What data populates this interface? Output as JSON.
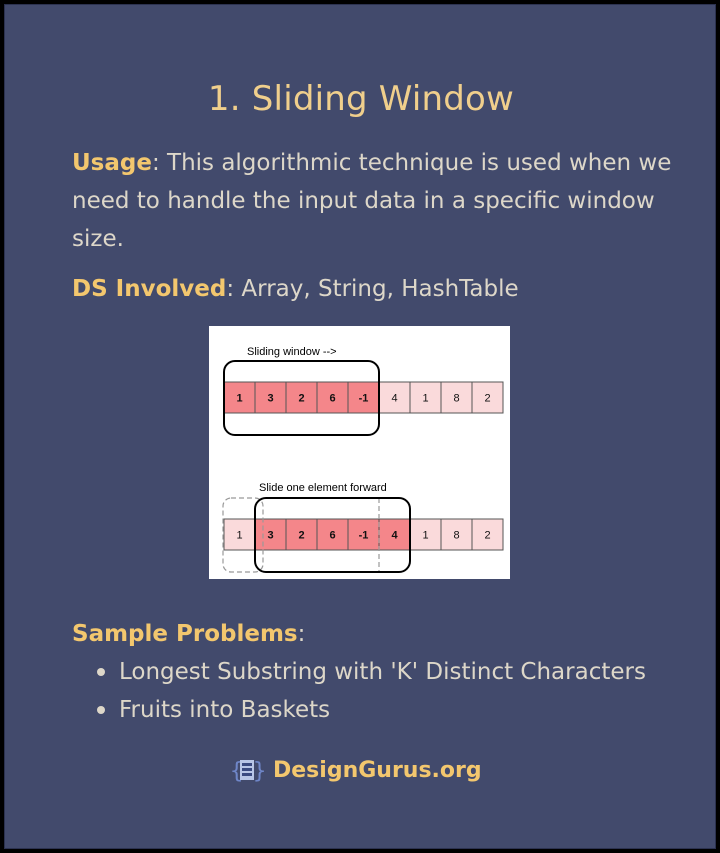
{
  "title": "1. Sliding Window",
  "usage": {
    "label": "Usage",
    "text": ": This algorithmic technique is used when we need to handle the input data in a specific window size."
  },
  "ds": {
    "label": "DS Involved",
    "text": ": Array, String, HashTable"
  },
  "diagram": {
    "caption_top": "Sliding window -->",
    "caption_bottom": "Slide one element forward",
    "array": [
      "1",
      "3",
      "2",
      "6",
      "-1",
      "4",
      "1",
      "8",
      "2"
    ],
    "window_size": 5,
    "colors": {
      "window_cell": "#f4868a",
      "other_cell": "#fadadb"
    }
  },
  "sample": {
    "label": "Sample Problems",
    "suffix": ":",
    "items": [
      "Longest Substring with 'K' Distinct Characters",
      "Fruits into Baskets"
    ]
  },
  "brand": {
    "name": "DesignGurus.org",
    "logo_icon": "designgurus-logo-icon"
  },
  "colors": {
    "background": "#424a6c",
    "accent": "#f3c76e",
    "text": "#ddd7c9"
  }
}
